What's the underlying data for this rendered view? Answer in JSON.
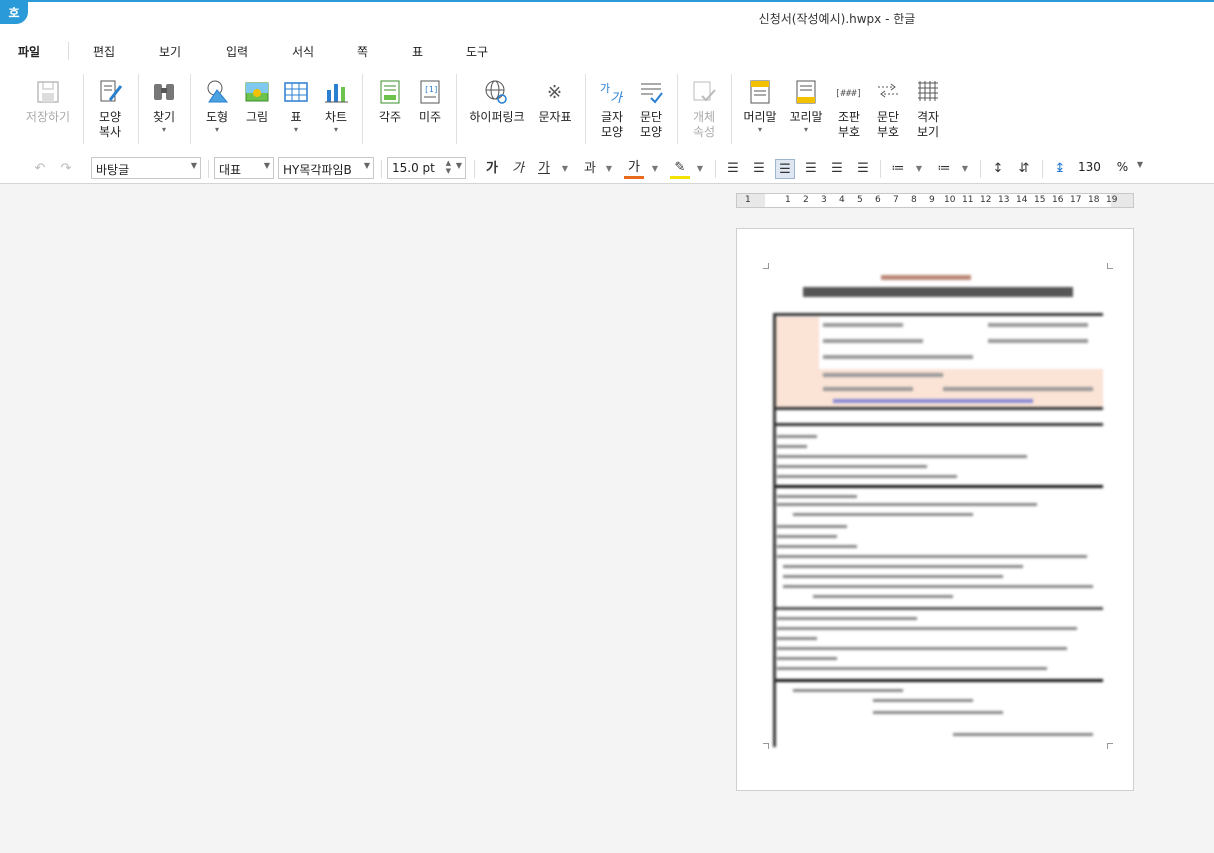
{
  "app": {
    "logo": "호",
    "title": "신청서(작성예시).hwpx - 한글"
  },
  "menu": [
    "파일",
    "편집",
    "보기",
    "입력",
    "서식",
    "쪽",
    "표",
    "도구"
  ],
  "ribbon": {
    "save": "저장하기",
    "shape_copy": "모양\n복사",
    "find": "찾기",
    "shape": "도형",
    "picture": "그림",
    "table": "표",
    "chart": "차트",
    "footnote": "각주",
    "endnote": "미주",
    "hyperlink": "하이퍼링크",
    "char_map": "문자표",
    "char_shape": "글자\n모양",
    "para_shape": "문단\n모양",
    "obj_props": "개체\n속성",
    "header": "머리말",
    "footer": "꼬리말",
    "layout_code": "조판\n부호",
    "para_mark": "문단\n부호",
    "grid": "격자\n보기"
  },
  "format": {
    "style": "바탕글",
    "lang": "대표",
    "font": "HY목각파임B",
    "size": "15.0",
    "unit": "pt",
    "bold": "가",
    "italic": "가",
    "underline": "가",
    "strike": "과",
    "color": "가",
    "zoom": "130",
    "zoom_unit": "%"
  },
  "ruler": [
    "1",
    "1",
    "2",
    "3",
    "4",
    "5",
    "6",
    "7",
    "8",
    "9",
    "10",
    "11",
    "12",
    "13",
    "14",
    "15",
    "16",
    "17",
    "18",
    "19"
  ],
  "colors": {
    "accent": "#2a9bd8",
    "bg": "#f4f4f4"
  }
}
